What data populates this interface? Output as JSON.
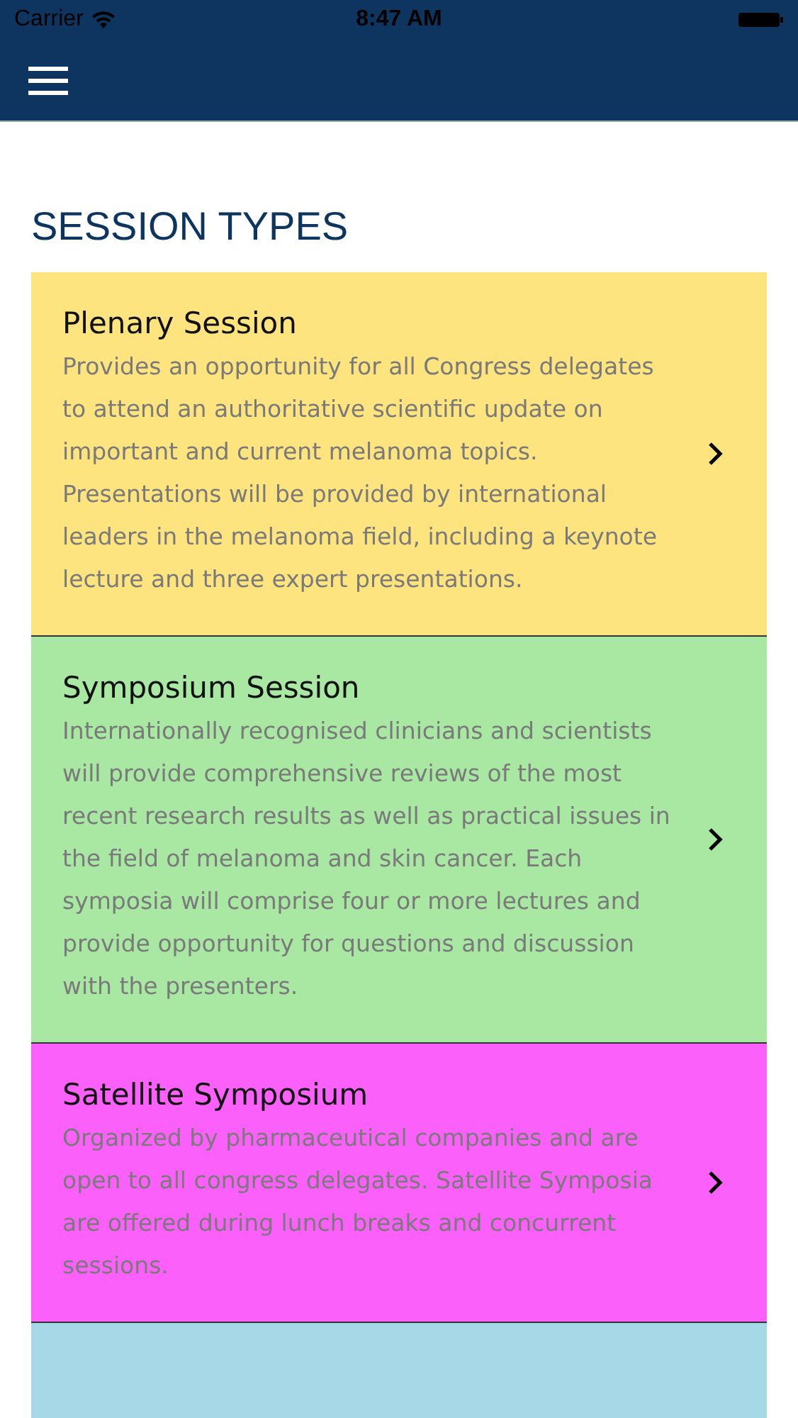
{
  "status_bar": {
    "carrier": "Carrier",
    "time": "8:47 AM"
  },
  "heading": "SESSION TYPES",
  "session_types": [
    {
      "title": "Plenary Session",
      "description": "Provides an opportunity for all Congress delegates to attend an authoritative scientific update on important and current melanoma topics. Presentations will be provided by international leaders in the melanoma field, including a keynote lecture and three expert presentations.",
      "color": "#fde47f"
    },
    {
      "title": "Symposium Session",
      "description": "Internationally recognised clinicians and scientists will provide comprehensive reviews of the most recent research results as well as practical issues in the field of melanoma and skin cancer. Each symposia will comprise four or more lectures and provide opportunity for questions and discussion with the presenters.",
      "color": "#a8e8a3"
    },
    {
      "title": "Satellite Symposium",
      "description": "Organized by pharmaceutical companies and are open to all congress delegates. Satellite Symposia are offered during lunch breaks and concurrent sessions.",
      "color": "#fb60fa"
    },
    {
      "color": "#a6d8e8"
    }
  ]
}
